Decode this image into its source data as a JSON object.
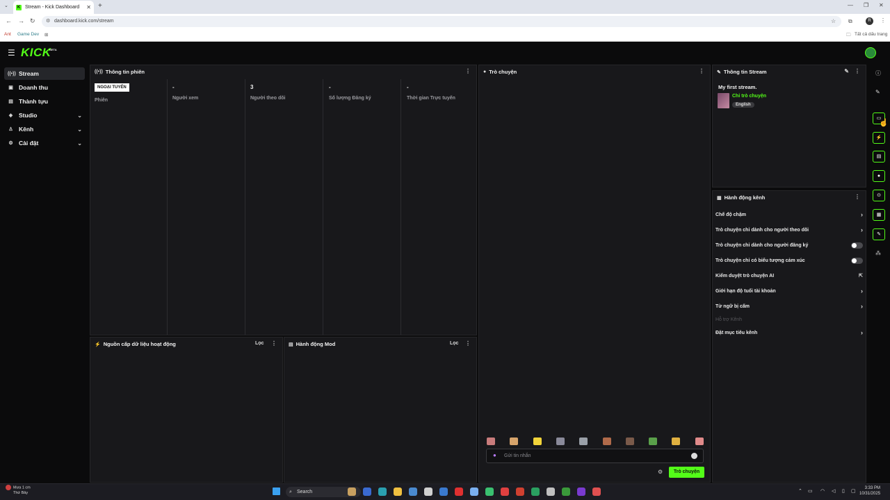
{
  "browser": {
    "tab_title": "Stream - Kick Dashboard",
    "url": "dashboard.kick.com/stream",
    "bookmarks": [
      "Ant",
      "Game Dev"
    ],
    "bookmarks_all": "Tất cả dấu trang",
    "profile_letter": "R"
  },
  "brand": {
    "logo": "KICK",
    "beta": "BETA",
    "accent": "#53fc18"
  },
  "sidebar": {
    "items": [
      {
        "label": "Stream",
        "icon": "broadcast-icon",
        "active": true
      },
      {
        "label": "Doanh thu",
        "icon": "wallet-icon"
      },
      {
        "label": "Thành tựu",
        "icon": "trophy-icon"
      },
      {
        "label": "Studio",
        "icon": "palette-icon",
        "expandable": true
      },
      {
        "label": "Kênh",
        "icon": "people-icon",
        "expandable": true
      },
      {
        "label": "Cài đặt",
        "icon": "gear-icon",
        "expandable": true
      }
    ]
  },
  "session": {
    "title": "Thông tin phiên",
    "status_badge": "NGOẠI TUYẾN",
    "status_label": "Phiên",
    "stats": [
      {
        "value": "-",
        "label": "Người xem"
      },
      {
        "value": "3",
        "label": "Người theo dõi"
      },
      {
        "value": "-",
        "label": "Số lượng Đăng ký"
      },
      {
        "value": "-",
        "label": "Thời gian Trực tuyến"
      }
    ]
  },
  "activity_feed": {
    "title": "Nguồn cấp dữ liệu hoạt động",
    "filter": "Lọc"
  },
  "mod_actions": {
    "title": "Hành động Mod",
    "filter": "Lọc"
  },
  "chat": {
    "title": "Trò chuyện",
    "placeholder": "Gửi tin nhắn",
    "send_label": "Trò chuyện",
    "emotes": [
      "#c97c7c",
      "#d7a46b",
      "#f2d43a",
      "#8a8a9a",
      "#9aa0a8",
      "#b06a4a",
      "#7a5a4a",
      "#5aa04a",
      "#e0b040",
      "#e08a8a"
    ]
  },
  "stream_info": {
    "title": "Thông tin Stream",
    "stream_title": "My first stream.",
    "category": "Chỉ trò chuyện",
    "language": "English"
  },
  "channel_actions": {
    "title": "Hành động kênh",
    "rows": [
      {
        "label": "Chế độ chậm",
        "control": "chevron"
      },
      {
        "label": "Trò chuyện chỉ dành cho người theo dõi",
        "control": "chevron"
      },
      {
        "label": "Trò chuyện chỉ dành cho người đăng ký",
        "control": "toggle"
      },
      {
        "label": "Trò chuyện chỉ có biểu tượng cảm xúc",
        "control": "toggle"
      },
      {
        "label": "Kiểm duyệt trò chuyện AI",
        "control": "external"
      },
      {
        "label": "Giới hạn độ tuổi tài khoản",
        "control": "chevron"
      },
      {
        "label": "Từ ngữ bị cấm",
        "control": "chevron"
      },
      {
        "label": "Hỗ trợ Kênh",
        "control": "none",
        "disabled": true
      },
      {
        "label": "Đặt mục tiêu kênh",
        "control": "chevron"
      }
    ]
  },
  "taskbar": {
    "weather_line1": "Mưa 1 cm",
    "weather_line2": "Thứ Bảy",
    "weather_badge": "4",
    "search": "Search",
    "time": "3:33 PM",
    "date": "10/31/2025"
  }
}
